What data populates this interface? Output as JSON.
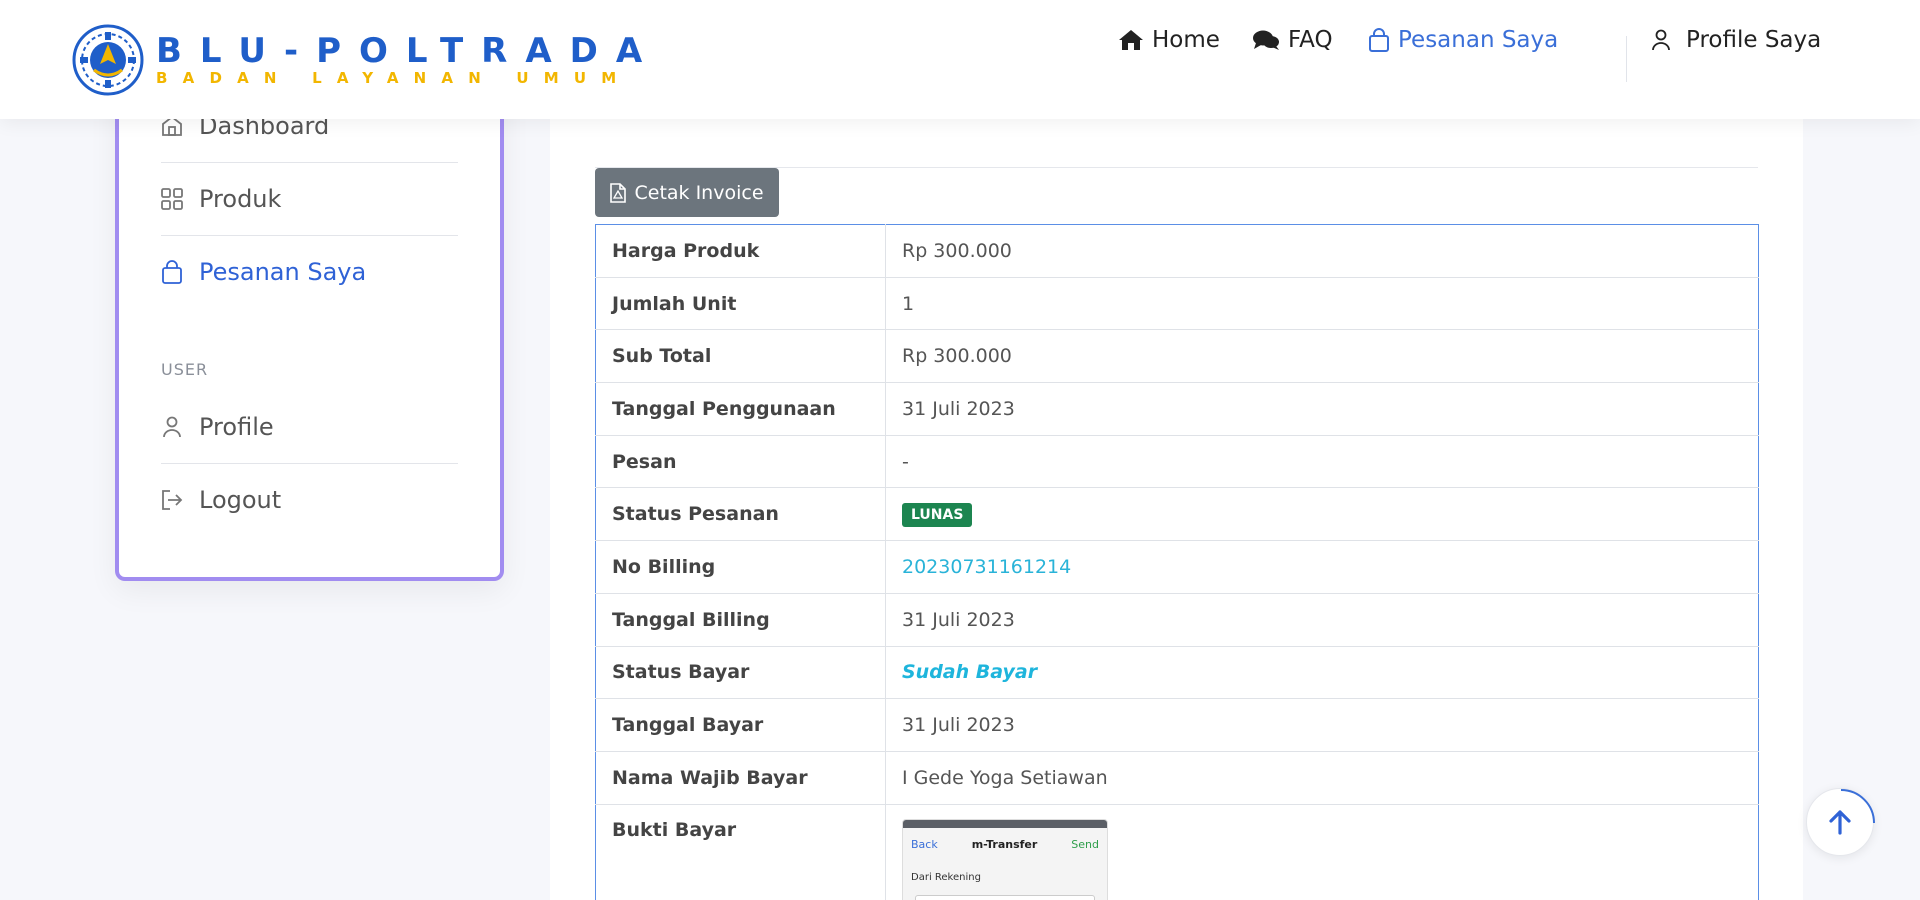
{
  "brand": {
    "title": "BLU-POLTRADA",
    "subtitle": "BADAN LAYANAN UMUM",
    "title_color": "#1f5ec9",
    "subtitle_color": "#f2b600"
  },
  "nav": {
    "home": "Home",
    "faq": "FAQ",
    "pesanan": "Pesanan Saya",
    "profile": "Profile Saya",
    "active_color": "#3a6fd8"
  },
  "sidebar": {
    "items": [
      {
        "label": "Dashboard",
        "icon": "home-icon"
      },
      {
        "label": "Produk",
        "icon": "grid-icon"
      },
      {
        "label": "Pesanan Saya",
        "icon": "shopping-bag-icon",
        "active": true
      }
    ],
    "section_user": "USER",
    "user_items": [
      {
        "label": "Profile",
        "icon": "user-icon"
      },
      {
        "label": "Logout",
        "icon": "logout-icon"
      }
    ]
  },
  "actions": {
    "cetak_invoice": "Cetak Invoice"
  },
  "order": {
    "rows": [
      {
        "label": "Harga Produk",
        "value": "Rp 300.000"
      },
      {
        "label": "Jumlah Unit",
        "value": "1"
      },
      {
        "label": "Sub Total",
        "value": "Rp 300.000"
      },
      {
        "label": "Tanggal Penggunaan",
        "value": "31 Juli 2023"
      },
      {
        "label": "Pesan",
        "value": "-"
      },
      {
        "label": "Status Pesanan",
        "value": "LUNAS"
      },
      {
        "label": "No Billing",
        "value": "20230731161214"
      },
      {
        "label": "Tanggal Billing",
        "value": "31 Juli 2023"
      },
      {
        "label": "Status Bayar",
        "value": "Sudah Bayar"
      },
      {
        "label": "Tanggal Bayar",
        "value": "31 Juli 2023"
      },
      {
        "label": "Nama Wajib Bayar",
        "value": "I Gede Yoga Setiawan"
      },
      {
        "label": "Bukti Bayar",
        "value": ""
      }
    ],
    "proof_thumbnail": {
      "back": "Back",
      "title": "m-Transfer",
      "send": "Send",
      "from": "Dari Rekening"
    }
  }
}
